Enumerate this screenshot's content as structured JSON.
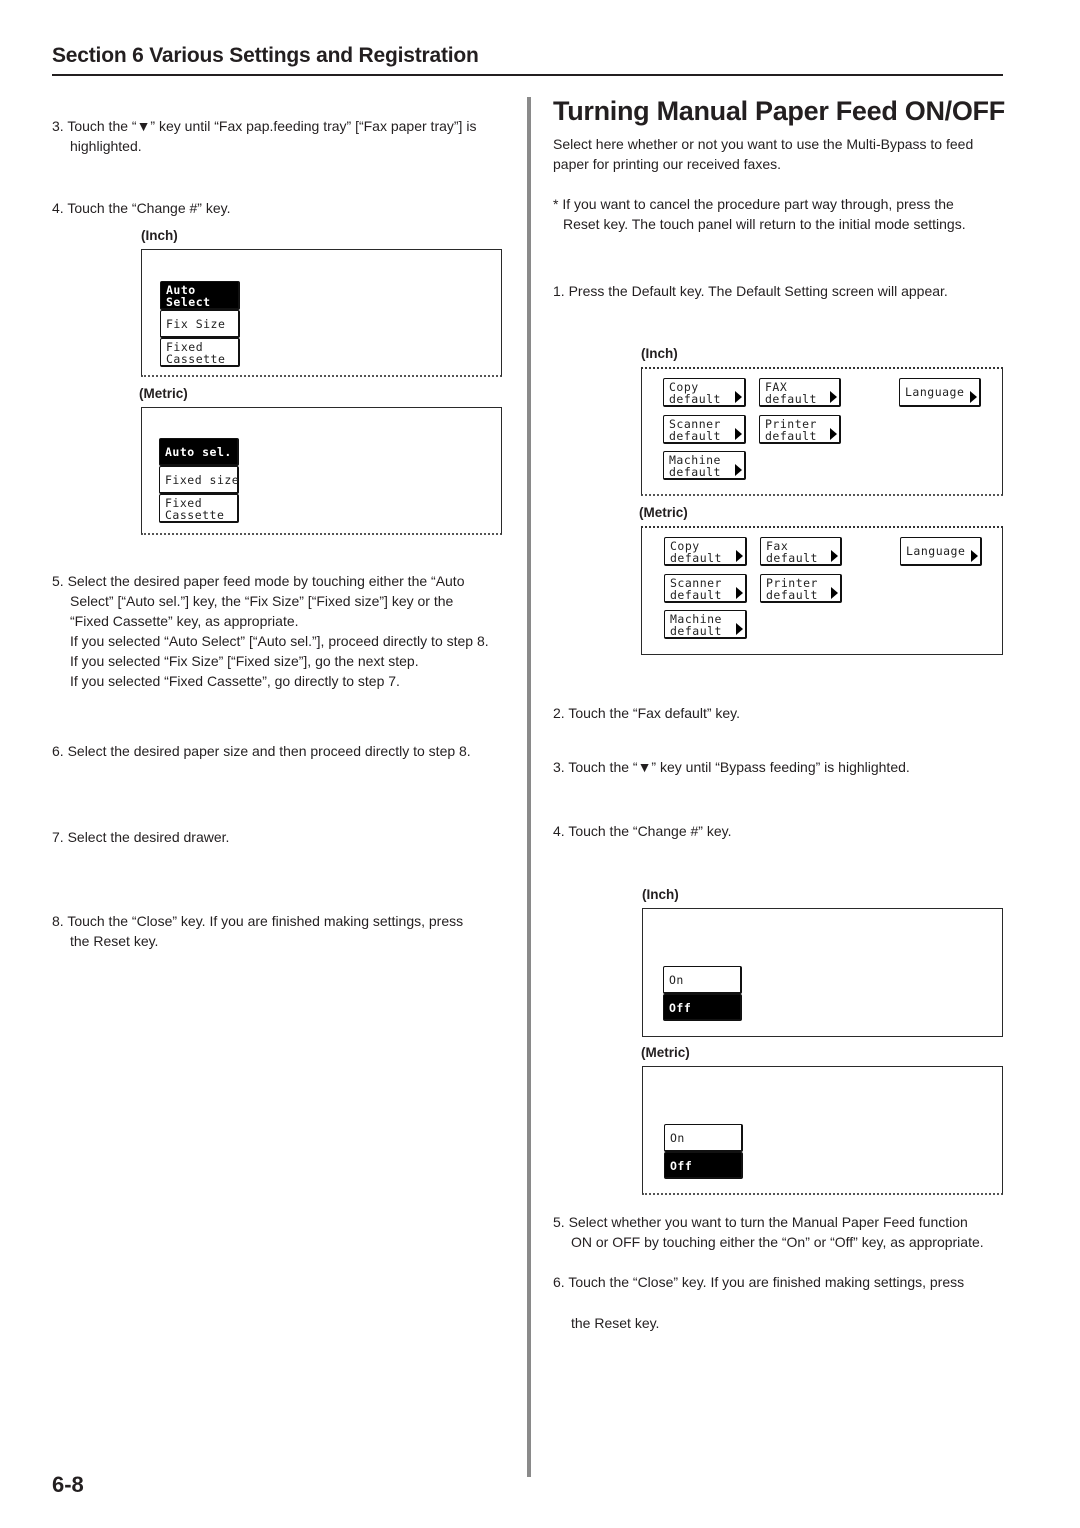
{
  "header": {
    "section_title": "Section 6  Various Settings and Registration"
  },
  "left_column": {
    "step3": [
      "3. Touch the “▼” key until “Fax pap.feeding tray” [“Fax paper tray”] is",
      "highlighted."
    ],
    "step4": "4. Touch the “Change #” key.",
    "inch_caption": "(Inch)",
    "inch_panel": {
      "buttons": [
        {
          "lines": [
            "Auto",
            "Select"
          ],
          "selected": true
        },
        {
          "lines": [
            "Fix Size"
          ],
          "selected": false
        },
        {
          "lines": [
            "Fixed",
            "Cassette"
          ],
          "selected": false
        }
      ]
    },
    "metric_caption": "(Metric)",
    "metric_panel": {
      "buttons": [
        {
          "lines": [
            "Auto sel."
          ],
          "selected": true
        },
        {
          "lines": [
            "Fixed size"
          ],
          "selected": false
        },
        {
          "lines": [
            "Fixed",
            "Cassette"
          ],
          "selected": false
        }
      ]
    },
    "step5": [
      "5. Select the desired paper feed mode by touching either the “Auto",
      "Select” [“Auto sel.”] key, the “Fix Size” [“Fixed size”] key or the",
      "“Fixed Cassette” key, as appropriate.",
      "If you selected “Auto Select” [“Auto sel.”], proceed directly to step 8.",
      "If you selected “Fix Size” [“Fixed size”], go the next step.",
      "If you selected “Fixed Cassette”, go directly to step 7."
    ],
    "step6": "6. Select the desired paper size and then proceed directly to step 8.",
    "step7": "7. Select the desired drawer.",
    "step8": [
      "8. Touch the “Close” key. If you are finished making settings, press",
      "the Reset key."
    ]
  },
  "right_column": {
    "title": "Turning Manual Paper Feed ON/OFF",
    "intro": [
      "Select here whether or not you want to use the Multi-Bypass to feed",
      "paper for printing our received faxes."
    ],
    "note": [
      "* If you want to cancel the procedure part way through, press the",
      "Reset key. The touch panel will return to the initial mode settings."
    ],
    "step1": "1. Press the Default key. The Default Setting screen will appear.",
    "inch_caption": "(Inch)",
    "inch_default_panel": {
      "copy": [
        "Copy",
        "default"
      ],
      "fax": [
        "FAX",
        "default"
      ],
      "language": "Language",
      "scanner": [
        "Scanner",
        "default"
      ],
      "printer": [
        "Printer",
        "default"
      ],
      "machine": [
        "Machine",
        "default"
      ]
    },
    "metric_caption": "(Metric)",
    "metric_default_panel": {
      "copy": [
        "Copy",
        "default"
      ],
      "fax": [
        "Fax",
        "default"
      ],
      "language": "Language",
      "scanner": [
        "Scanner",
        "default"
      ],
      "printer": [
        "Printer",
        "default"
      ],
      "machine": [
        "Machine",
        "default"
      ]
    },
    "step2": "2. Touch the “Fax default” key.",
    "step3": "3. Touch the “▼” key until “Bypass feeding” is highlighted.",
    "step4": "4. Touch the “Change #” key.",
    "inch_caption2": "(Inch)",
    "inch_onoff": {
      "on": "On",
      "off": "Off",
      "selected": "Off"
    },
    "metric_caption2": "(Metric)",
    "metric_onoff": {
      "on": "On",
      "off": "Off",
      "selected": "Off"
    },
    "step5": [
      "5. Select whether you want to turn the Manual Paper Feed function",
      "ON or OFF by touching either the “On” or “Off” key, as appropriate."
    ],
    "step6": [
      "6. Touch the “Close” key. If you are finished making settings, press",
      "the Reset key."
    ]
  },
  "footer": {
    "page_number": "6-8"
  }
}
